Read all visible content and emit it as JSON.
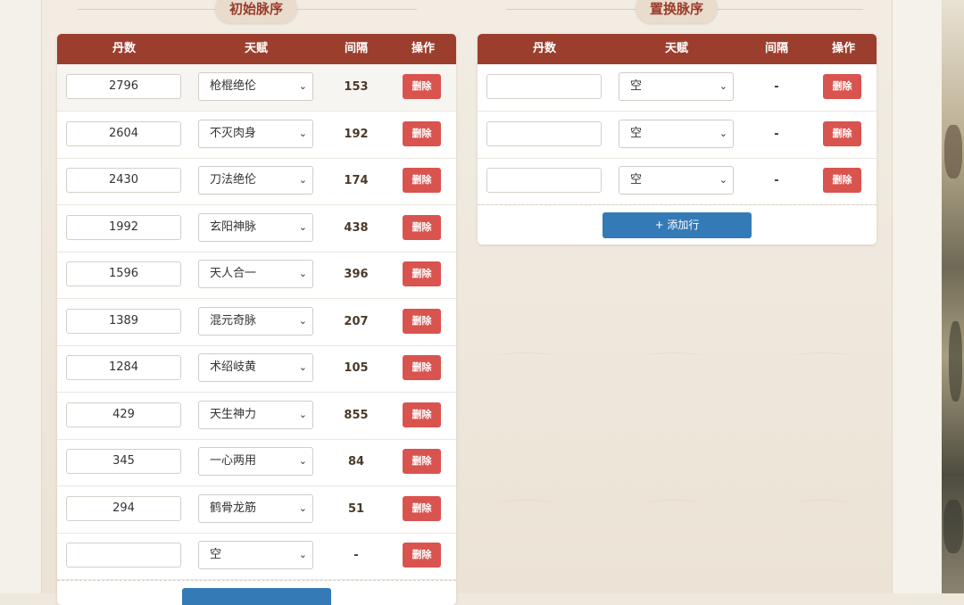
{
  "columns": {
    "pills": "丹数",
    "talent": "天赋",
    "interval": "间隔",
    "action": "操作"
  },
  "left": {
    "title": "初始脉序",
    "rows": [
      {
        "pills": "2796",
        "talent": "枪棍绝伦",
        "interval": "153",
        "delete": "删除"
      },
      {
        "pills": "2604",
        "talent": "不灭肉身",
        "interval": "192",
        "delete": "删除"
      },
      {
        "pills": "2430",
        "talent": "刀法绝伦",
        "interval": "174",
        "delete": "删除"
      },
      {
        "pills": "1992",
        "talent": "玄阳神脉",
        "interval": "438",
        "delete": "删除"
      },
      {
        "pills": "1596",
        "talent": "天人合一",
        "interval": "396",
        "delete": "删除"
      },
      {
        "pills": "1389",
        "talent": "混元奇脉",
        "interval": "207",
        "delete": "删除"
      },
      {
        "pills": "1284",
        "talent": "术绍岐黄",
        "interval": "105",
        "delete": "删除"
      },
      {
        "pills": "429",
        "talent": "天生神力",
        "interval": "855",
        "delete": "删除"
      },
      {
        "pills": "345",
        "talent": "一心两用",
        "interval": "84",
        "delete": "删除"
      },
      {
        "pills": "294",
        "talent": "鹤骨龙筋",
        "interval": "51",
        "delete": "删除"
      },
      {
        "pills": "",
        "talent": "空",
        "interval": "-",
        "delete": "删除"
      }
    ]
  },
  "right": {
    "title": "置换脉序",
    "rows": [
      {
        "pills": "",
        "talent": "空",
        "interval": "-",
        "delete": "删除"
      },
      {
        "pills": "",
        "talent": "空",
        "interval": "-",
        "delete": "删除"
      },
      {
        "pills": "",
        "talent": "空",
        "interval": "-",
        "delete": "删除"
      }
    ],
    "add_label": "+ 添加行"
  },
  "colors": {
    "header": "#9b3e2e",
    "delete": "#d9534f",
    "add": "#337ab7",
    "title_text": "#9b3b2a"
  },
  "icons": {
    "select_arrow": "chevron-down-icon"
  }
}
